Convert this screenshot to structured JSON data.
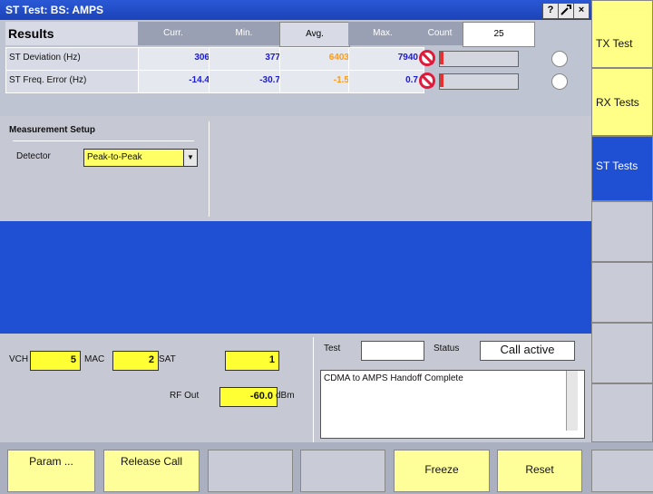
{
  "window": {
    "title": "ST Test: BS: AMPS",
    "buttons": [
      "?",
      "wrench",
      "x"
    ]
  },
  "results": {
    "title": "Results",
    "columns": [
      "Curr.",
      "Min.",
      "Avg.",
      "Max.",
      "Count"
    ],
    "count_value": "25",
    "rows": [
      {
        "label": "ST Deviation (Hz)",
        "curr": "306",
        "min": "377",
        "avg": "6403",
        "max": "7940"
      },
      {
        "label": "ST Freq. Error (Hz)",
        "curr": "-14.4",
        "min": "-30.7",
        "avg": "-1.5",
        "max": "0.7"
      }
    ]
  },
  "setup": {
    "title": "Measurement Setup",
    "detector_label": "Detector",
    "detector_value": "Peak-to-Peak"
  },
  "lower": {
    "vch_label": "VCH",
    "vch_value": "5",
    "mac_label": "MAC",
    "mac_value": "2",
    "sat_label": "SAT",
    "sat_value": "1",
    "rfout_label": "RF Out",
    "rfout_value": "-60.0",
    "rfout_unit": "dBm",
    "test_label": "Test",
    "test_value": "",
    "status_label": "Status",
    "status_value": "Call active",
    "message": "CDMA to AMPS Handoff Complete"
  },
  "softkeys": [
    {
      "label": "Param ..."
    },
    {
      "label": "Release Call"
    },
    {
      "label": ""
    },
    {
      "label": ""
    },
    {
      "label": "Freeze"
    },
    {
      "label": "Reset"
    },
    {
      "label": ""
    }
  ],
  "tabs": [
    {
      "label": "TX Test"
    },
    {
      "label": "RX Tests"
    },
    {
      "label": "ST Tests"
    },
    {
      "label": ""
    },
    {
      "label": ""
    },
    {
      "label": ""
    },
    {
      "label": ""
    }
  ]
}
